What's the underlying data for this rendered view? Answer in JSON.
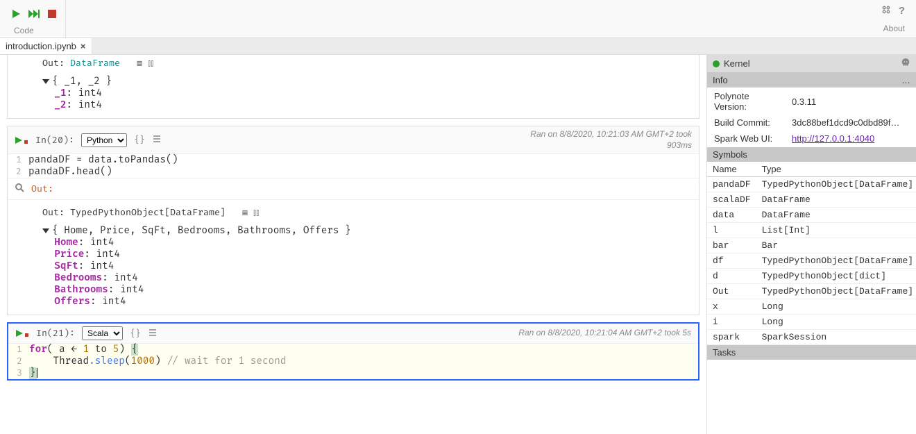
{
  "toolbar": {
    "group_label": "Code",
    "about_label": "About"
  },
  "tab": {
    "name": "introduction.ipynb"
  },
  "cell_out0": {
    "out_label": "Out:",
    "type_label": "DataFrame",
    "schema_header": "{ _1, _2 }",
    "fields": [
      {
        "name": "_1",
        "type": "int4"
      },
      {
        "name": "_2",
        "type": "int4"
      }
    ]
  },
  "cell20": {
    "in_label": "In(20):",
    "language": "Python",
    "run_info_line1": "Ran on 8/8/2020, 10:21:03 AM GMT+2 took",
    "run_info_line2": "903ms",
    "code_line1": "pandaDF = data.toPandas()",
    "code_line2": "pandaDF.head()",
    "out_label": "Out:",
    "out2_label": "Out:",
    "out2_type": "TypedPythonObject[DataFrame]",
    "schema_header": "{ Home, Price, SqFt, Bedrooms, Bathrooms, Offers }",
    "fields": [
      {
        "name": "Home",
        "type": "int4"
      },
      {
        "name": "Price",
        "type": "int4"
      },
      {
        "name": "SqFt",
        "type": "int4"
      },
      {
        "name": "Bedrooms",
        "type": "int4"
      },
      {
        "name": "Bathrooms",
        "type": "int4"
      },
      {
        "name": "Offers",
        "type": "int4"
      }
    ]
  },
  "cell21": {
    "in_label": "In(21):",
    "language": "Scala",
    "run_info": "Ran on 8/8/2020, 10:21:04 AM GMT+2 took 5s",
    "code": {
      "l1_kw": "for",
      "l1_rest1": "( a ← ",
      "l1_num1": "1",
      "l1_to": " to ",
      "l1_num2": "5",
      "l1_rest2": ") ",
      "l2_indent": "    ",
      "l2_ident": "Thread",
      "l2_method": ".sleep",
      "l2_open": "(",
      "l2_num": "1000",
      "l2_close": ") ",
      "l2_comment": "// wait for 1 second"
    }
  },
  "kernel": {
    "header": "Kernel",
    "info_header": "Info",
    "version_label": "Polynote Version:",
    "version_value": "0.3.11",
    "commit_label": "Build Commit:",
    "commit_value": "3dc88bef1dcd9c0dbd89f…",
    "spark_label": "Spark Web UI:",
    "spark_value": "http://127.0.0.1:4040",
    "symbols_header": "Symbols",
    "name_header": "Name",
    "type_header": "Type",
    "symbols": [
      {
        "name": "pandaDF",
        "type": "TypedPythonObject[DataFrame]"
      },
      {
        "name": "scalaDF",
        "type": "DataFrame"
      },
      {
        "name": "data",
        "type": "DataFrame"
      },
      {
        "name": "l",
        "type": "List[Int]"
      },
      {
        "name": "bar",
        "type": "Bar"
      },
      {
        "name": "df",
        "type": "TypedPythonObject[DataFrame]"
      },
      {
        "name": "d",
        "type": "TypedPythonObject[dict]"
      },
      {
        "name": "Out",
        "type": "TypedPythonObject[DataFrame]"
      },
      {
        "name": "x",
        "type": "Long"
      },
      {
        "name": "i",
        "type": "Long"
      },
      {
        "name": "spark",
        "type": "SparkSession"
      }
    ],
    "tasks_header": "Tasks"
  }
}
